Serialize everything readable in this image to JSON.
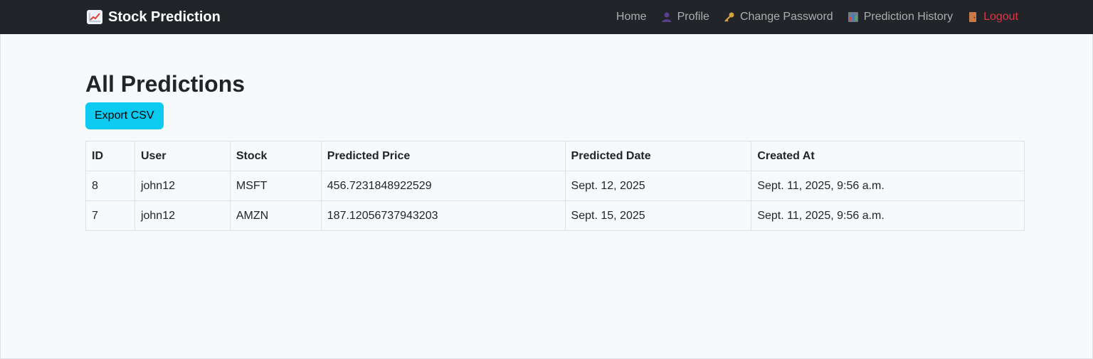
{
  "navbar": {
    "brand": "Stock Prediction",
    "brand_icon": "chart-increasing-icon",
    "links": [
      {
        "label": "Home",
        "icon": ""
      },
      {
        "label": "Profile",
        "icon": "user-icon"
      },
      {
        "label": "Change Password",
        "icon": "key-icon"
      },
      {
        "label": "Prediction History",
        "icon": "bar-chart-icon"
      },
      {
        "label": "Logout",
        "icon": "door-icon"
      }
    ]
  },
  "main": {
    "title": "All Predictions",
    "export_label": "Export CSV",
    "table": {
      "headers": [
        "ID",
        "User",
        "Stock",
        "Predicted Price",
        "Predicted Date",
        "Created At"
      ],
      "rows": [
        [
          "8",
          "john12",
          "MSFT",
          "456.7231848922529",
          "Sept. 12, 2025",
          "Sept. 11, 2025, 9:56 a.m."
        ],
        [
          "7",
          "john12",
          "AMZN",
          "187.12056737943203",
          "Sept. 15, 2025",
          "Sept. 11, 2025, 9:56 a.m."
        ]
      ]
    }
  },
  "colors": {
    "navbar_bg": "#212529",
    "export_button": "#0dcaf0",
    "logout": "#dc3545",
    "page_bg": "#f8f9fa"
  }
}
